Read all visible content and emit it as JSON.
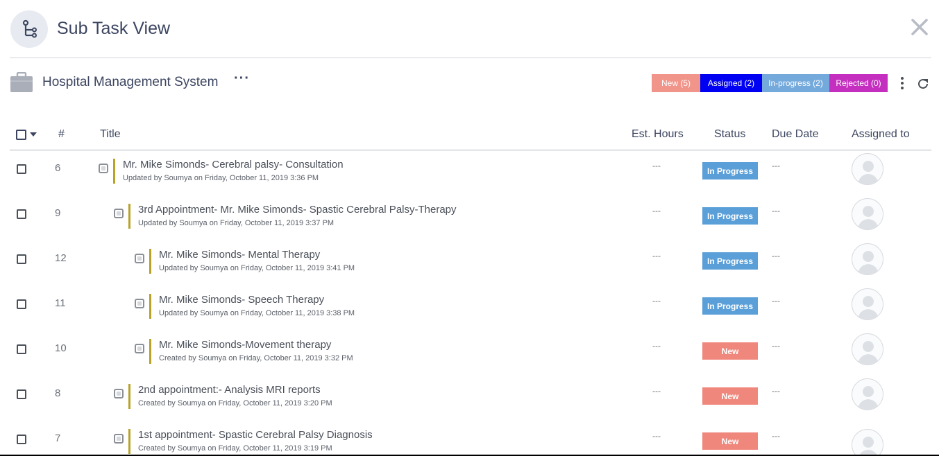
{
  "header": {
    "title": "Sub Task View"
  },
  "project": {
    "name": "Hospital Management System",
    "more": "···"
  },
  "filters": [
    {
      "label": "New (5)",
      "color": "#f1948a"
    },
    {
      "label": "Assigned (2)",
      "color": "#0000f2"
    },
    {
      "label": "In-progress (2)",
      "color": "#74a9dc"
    },
    {
      "label": "Rejected (0)",
      "color": "#c42fbf"
    }
  ],
  "columns": {
    "num": "#",
    "title": "Title",
    "est": "Est. Hours",
    "status": "Status",
    "due": "Due Date",
    "assigned": "Assigned to"
  },
  "tasks": [
    {
      "num": "6",
      "title": "Mr. Mike Simonds- Cerebral palsy- Consultation",
      "meta": "Updated by Soumya on Friday, October 11, 2019 3:36 PM",
      "est": "---",
      "status": "In Progress",
      "due": "---"
    },
    {
      "num": "9",
      "title": "3rd Appointment- Mr. Mike Simonds- Spastic Cerebral Palsy-Therapy",
      "meta": "Updated by Soumya on Friday, October 11, 2019 3:37 PM",
      "est": "---",
      "status": "In Progress",
      "due": "---"
    },
    {
      "num": "12",
      "title": "Mr. Mike Simonds- Mental Therapy",
      "meta": "Updated by Soumya on Friday, October 11, 2019 3:41 PM",
      "est": "---",
      "status": "In Progress",
      "due": "---"
    },
    {
      "num": "11",
      "title": "Mr. Mike Simonds- Speech Therapy",
      "meta": "Updated by Soumya on Friday, October 11, 2019 3:38 PM",
      "est": "---",
      "status": "In Progress",
      "due": "---"
    },
    {
      "num": "10",
      "title": "Mr. Mike Simonds-Movement therapy",
      "meta": "Created by Soumya on Friday, October 11, 2019 3:32 PM",
      "est": "---",
      "status": "New",
      "due": "---"
    },
    {
      "num": "8",
      "title": "2nd appointment:- Analysis MRI reports",
      "meta": "Created by Soumya on Friday, October 11, 2019 3:20 PM",
      "est": "---",
      "status": "New",
      "due": "---"
    },
    {
      "num": "7",
      "title": "1st appointment- Spastic Cerebral Palsy Diagnosis",
      "meta": "Created by Soumya on Friday, October 11, 2019 3:19 PM",
      "est": "---",
      "status": "New",
      "due": "---"
    }
  ]
}
